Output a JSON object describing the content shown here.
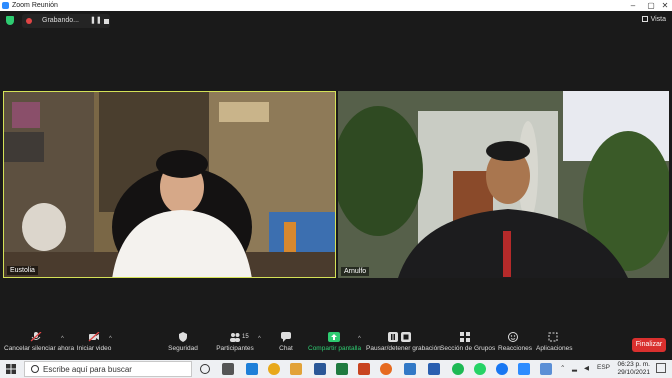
{
  "window": {
    "title": "Zoom Reunión",
    "min_glyph": "–",
    "max_glyph": "▢",
    "close_glyph": "✕"
  },
  "recording": {
    "label": "Grabando...",
    "pause_glyph": "❚❚"
  },
  "view_button": {
    "label": "Vista"
  },
  "participants_video": [
    {
      "name": "Eustolia",
      "active_speaker": true
    },
    {
      "name": "Arnulfo",
      "active_speaker": false
    }
  ],
  "toolbar": {
    "mute_label": "Cancelar silenciar ahora",
    "video_label": "Iniciar video",
    "security_label": "Seguridad",
    "participants_label": "Participantes",
    "participants_count": "15",
    "chat_label": "Chat",
    "share_label": "Compartir pantalla",
    "record_label": "Pausar/detener grabación",
    "breakout_label": "Sección de Grupos",
    "reactions_label": "Reacciones",
    "apps_label": "Aplicaciones",
    "end_label": "Finalizar",
    "caret_glyph": "^"
  },
  "taskbar": {
    "search_placeholder": "Escribe aquí para buscar",
    "lang": "ESP",
    "time": "06:23 p. m.",
    "date": "29/10/2021"
  },
  "colors": {
    "active_border": "#d4e157",
    "share_green": "#2ecc71",
    "end_red": "#d9302e",
    "rec_red": "#e04545"
  }
}
